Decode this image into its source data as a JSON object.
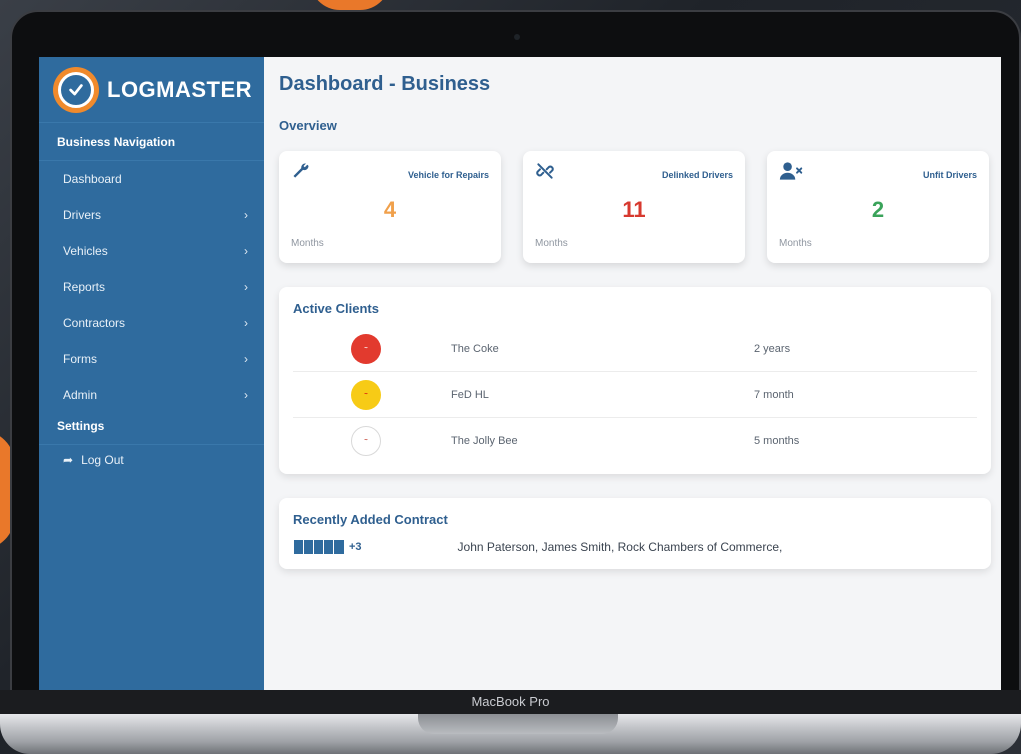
{
  "laptop": {
    "model_label": "MacBook Pro"
  },
  "sidebar": {
    "logo_text": "LOGMASTER",
    "section_title": "Business Navigation",
    "items": [
      {
        "label": "Dashboard",
        "has_submenu": false
      },
      {
        "label": "Drivers",
        "has_submenu": true
      },
      {
        "label": "Vehicles",
        "has_submenu": true
      },
      {
        "label": "Reports",
        "has_submenu": true
      },
      {
        "label": "Contractors",
        "has_submenu": true
      },
      {
        "label": "Forms",
        "has_submenu": true
      },
      {
        "label": "Admin",
        "has_submenu": true
      }
    ],
    "settings_label": "Settings",
    "logout_label": "Log Out"
  },
  "main": {
    "title": "Dashboard - Business",
    "overview_label": "Overview",
    "cards": [
      {
        "label": "Vehicle for Repairs",
        "value": "4",
        "footer": "Months",
        "color": "#f0a04b",
        "icon": "wrench-icon"
      },
      {
        "label": "Delinked Drivers",
        "value": "11",
        "footer": "Months",
        "color": "#d7392f",
        "icon": "unlink-icon"
      },
      {
        "label": "Unfit Drivers",
        "value": "2",
        "footer": "Months",
        "color": "#3aa35a",
        "icon": "user-x-icon"
      }
    ],
    "active_clients": {
      "title": "Active Clients",
      "rows": [
        {
          "name": "The Coke",
          "duration": "2 years",
          "logo_color": "#e23a2e"
        },
        {
          "name": "FeD HL",
          "duration": "7 month",
          "logo_color": "#f7cb16"
        },
        {
          "name": "The Jolly Bee",
          "duration": "5 months",
          "logo_color": "#ffffff"
        }
      ]
    },
    "recent_contract": {
      "title": "Recently Added Contract",
      "more_count": "+3",
      "names": "John Paterson, James Smith, Rock Chambers of Commerce,"
    }
  }
}
